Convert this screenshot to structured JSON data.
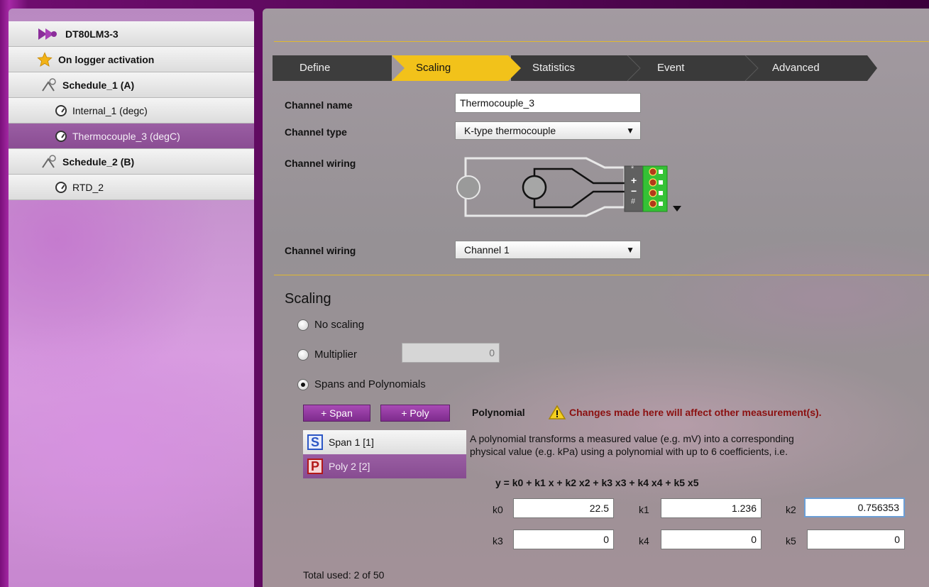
{
  "tree": {
    "items": [
      {
        "label": "DT80LM3-3",
        "icon": "logger-logo-icon",
        "level": 0,
        "bold": true,
        "selected": false
      },
      {
        "label": "On logger activation",
        "icon": "star-icon",
        "level": 0,
        "bold": true,
        "selected": false
      },
      {
        "label": "Schedule_1 (A)",
        "icon": "schedule-icon",
        "level": 0,
        "bold": true,
        "selected": false
      },
      {
        "label": "Internal_1 (degc)",
        "icon": "gauge-icon",
        "level": 1,
        "bold": false,
        "selected": false
      },
      {
        "label": "Thermocouple_3 (degC)",
        "icon": "gauge-icon",
        "level": 1,
        "bold": false,
        "selected": true
      },
      {
        "label": "Schedule_2 (B)",
        "icon": "schedule-icon",
        "level": 0,
        "bold": true,
        "selected": false
      },
      {
        "label": "RTD_2",
        "icon": "gauge-icon",
        "level": 1,
        "bold": false,
        "selected": false
      }
    ]
  },
  "tabs": [
    {
      "label": "Define",
      "active": false
    },
    {
      "label": "Scaling",
      "active": true
    },
    {
      "label": "Statistics",
      "active": false
    },
    {
      "label": "Event",
      "active": false
    },
    {
      "label": "Advanced",
      "active": false
    }
  ],
  "colors": {
    "accent": "#f2c21a",
    "tab_dark": "#3a3a3a",
    "warning_text": "#8b1010",
    "selected_row": "#8a4d93"
  },
  "form": {
    "channel_name_label": "Channel name",
    "channel_name_value": "Thermocouple_3",
    "channel_type_label": "Channel type",
    "channel_type_value": "K-type thermocouple",
    "channel_wiring_label": "Channel wiring",
    "wiring_terminals": [
      "*",
      "+",
      "−",
      "#"
    ],
    "channel_wiring2_label": "Channel wiring",
    "channel_wiring2_value": "Channel 1"
  },
  "scaling": {
    "title": "Scaling",
    "options": [
      {
        "label": "No scaling",
        "checked": false
      },
      {
        "label": "Multiplier",
        "checked": false
      },
      {
        "label": "Spans and Polynomials",
        "checked": true
      }
    ],
    "multiplier_value": "0",
    "add_span_label": "+ Span",
    "add_poly_label": "+ Poly",
    "list": [
      {
        "badge": "S",
        "label": "Span 1 [1]",
        "selected": false
      },
      {
        "badge": "P",
        "label": "Poly 2 [2]",
        "selected": true
      }
    ],
    "total_used": "Total used: 2 of 50"
  },
  "polynomial": {
    "title": "Polynomial",
    "warning": "Changes made here will affect other measurement(s).",
    "description_line1": "A polynomial transforms a measured value (e.g. mV) into a corresponding",
    "description_line2": "physical value (e.g. kPa) using a polynomial with up to 6 coefficients, i.e.",
    "formula": "y = k0 + k1 x + k2 x2 + k3 x3 + k4 x4 + k5 x5",
    "coefficients": [
      {
        "label": "k0",
        "value": "22.5"
      },
      {
        "label": "k1",
        "value": "1.236"
      },
      {
        "label": "k2",
        "value": "0.756353"
      },
      {
        "label": "k3",
        "value": "0"
      },
      {
        "label": "k4",
        "value": "0"
      },
      {
        "label": "k5",
        "value": "0"
      }
    ]
  }
}
